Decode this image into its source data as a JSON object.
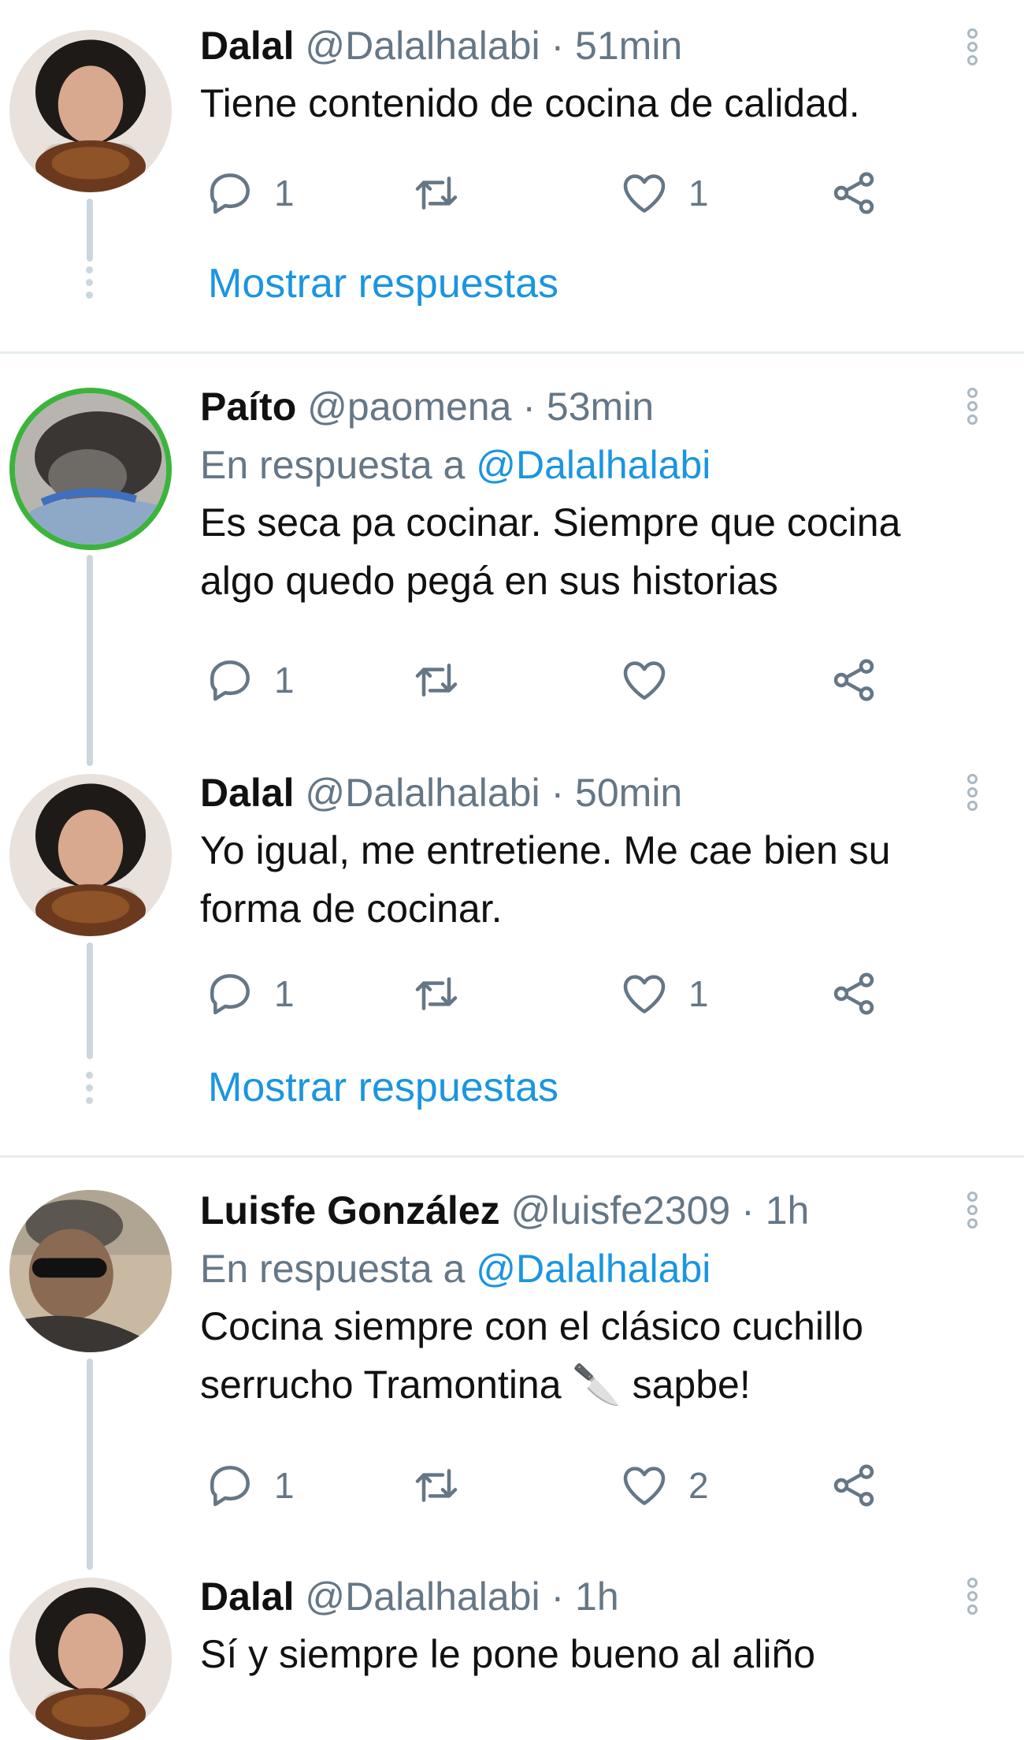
{
  "tweets": [
    {
      "name": "Dalal",
      "handle": "@Dalalhalabi",
      "time": "51min",
      "reply_prefix": "",
      "reply_to": "",
      "text": "Tiene contenido de cocina de calidad.",
      "replies": "1",
      "retweets": "",
      "likes": "1",
      "show_replies": "Mostrar respuestas"
    },
    {
      "name": "Paíto",
      "handle": "@paomena",
      "time": "53min",
      "reply_prefix": "En respuesta a",
      "reply_to": "@Dalalhalabi",
      "text": "Es seca pa cocinar. Siempre que cocina algo quedo pegá en sus historias",
      "replies": "1",
      "retweets": "",
      "likes": "",
      "show_replies": ""
    },
    {
      "name": "Dalal",
      "handle": "@Dalalhalabi",
      "time": "50min",
      "reply_prefix": "",
      "reply_to": "",
      "text": "Yo igual, me entretiene. Me cae bien su forma de cocinar.",
      "replies": "1",
      "retweets": "",
      "likes": "1",
      "show_replies": "Mostrar respuestas"
    },
    {
      "name": "Luisfe González",
      "handle": "@luisfe2309",
      "time": "1h",
      "reply_prefix": "En respuesta a",
      "reply_to": "@Dalalhalabi",
      "text": "Cocina siempre con el clásico cuchillo serrucho Tramontina 🔪 sapbe!",
      "replies": "1",
      "retweets": "",
      "likes": "2",
      "show_replies": ""
    },
    {
      "name": "Dalal",
      "handle": "@Dalalhalabi",
      "time": "1h",
      "reply_prefix": "",
      "reply_to": "",
      "text": "Sí y siempre le pone bueno al aliño",
      "replies": "",
      "retweets": "",
      "likes": "",
      "show_replies": ""
    }
  ],
  "icons": {
    "reply": "reply-icon",
    "retweet": "retweet-icon",
    "like": "heart-icon",
    "share": "share-icon",
    "more": "more-options-icon"
  },
  "colors": {
    "link": "#1b95e0",
    "muted": "#657786",
    "icon": "#657786",
    "avatar_ring": "#3cb43c",
    "separator": "#e6ecf0"
  }
}
